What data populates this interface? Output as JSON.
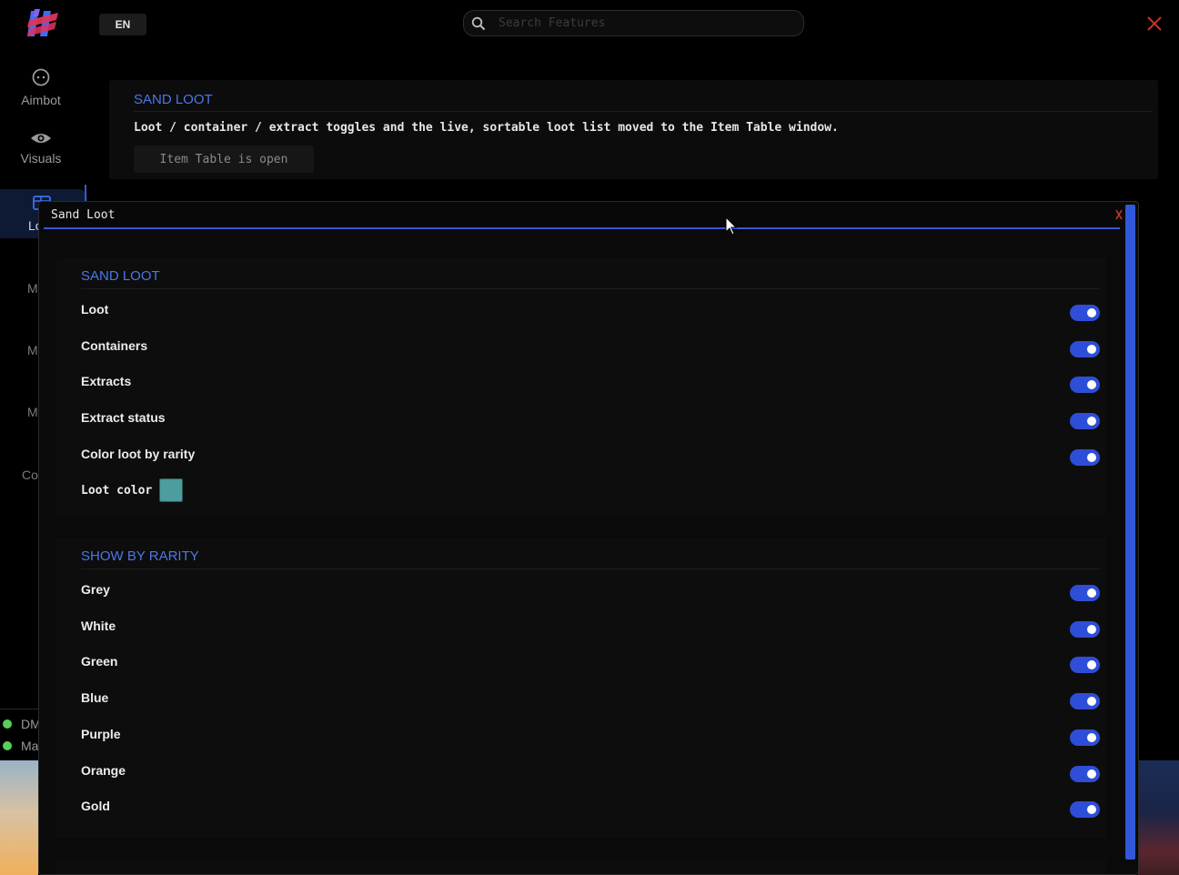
{
  "header": {
    "lang_label": "EN",
    "search_placeholder": "Search Features",
    "close_icon": "close-icon"
  },
  "sidebar": {
    "items": [
      {
        "label": "Aimbot",
        "icon": "target-icon"
      },
      {
        "label": "Visuals",
        "icon": "eye-icon"
      },
      {
        "label": "Lo",
        "icon": "loot-icon",
        "active": true
      },
      {
        "label": "M"
      },
      {
        "label": "M"
      },
      {
        "label": "M"
      },
      {
        "label": "Co"
      }
    ],
    "status": [
      {
        "label": "DM",
        "color": "#57d15a"
      },
      {
        "label": "Ma",
        "color": "#57d15a"
      }
    ]
  },
  "main": {
    "card_title": "SAND LOOT",
    "card_desc": "Loot / container / extract toggles and the live, sortable loot list moved to the Item Table window.",
    "item_table_button": "Item Table is open"
  },
  "loot_window": {
    "title": "Sand Loot",
    "sections": [
      {
        "title": "SAND LOOT",
        "toggles": [
          {
            "label": "Loot",
            "on": true
          },
          {
            "label": "Containers",
            "on": true
          },
          {
            "label": "Extracts",
            "on": true
          },
          {
            "label": "Extract status",
            "on": true
          },
          {
            "label": "Color loot by rarity",
            "on": true
          }
        ],
        "color_label": "Loot color",
        "color_value": "#4d9c9e"
      },
      {
        "title": "SHOW BY RARITY",
        "toggles": [
          {
            "label": "Grey",
            "on": true
          },
          {
            "label": "White",
            "on": true
          },
          {
            "label": "Green",
            "on": true
          },
          {
            "label": "Blue",
            "on": true
          },
          {
            "label": "Purple",
            "on": true
          },
          {
            "label": "Orange",
            "on": true
          },
          {
            "label": "Gold",
            "on": true
          }
        ]
      }
    ]
  },
  "colors": {
    "accent": "#3756d6",
    "section_title": "#4a78e8",
    "toggle_on": "#2e4ed8",
    "close_red": "#c0392b"
  }
}
